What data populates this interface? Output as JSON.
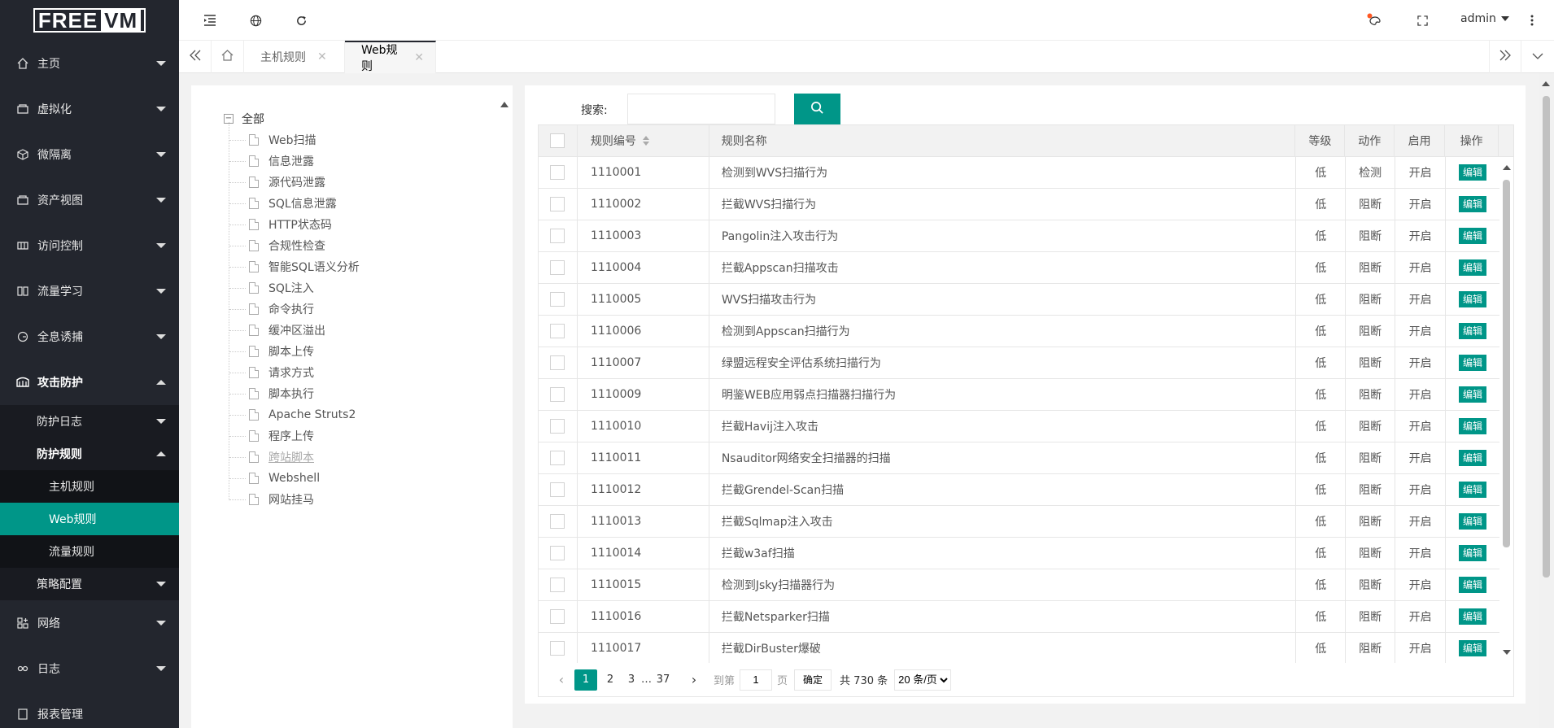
{
  "brand": {
    "logo_left": "FREE",
    "logo_right": "VM"
  },
  "sidebar": {
    "items": [
      {
        "label": "主页",
        "icon": "home-icon"
      },
      {
        "label": "虚拟化",
        "icon": "server-icon"
      },
      {
        "label": "微隔离",
        "icon": "cube-icon"
      },
      {
        "label": "资产视图",
        "icon": "server-icon"
      },
      {
        "label": "访问控制",
        "icon": "grid-icon"
      },
      {
        "label": "流量学习",
        "icon": "book-icon"
      },
      {
        "label": "全息诱捕",
        "icon": "radar-icon"
      },
      {
        "label": "攻击防护",
        "icon": "shield-icon"
      }
    ],
    "attack_sub": [
      {
        "label": "防护日志"
      },
      {
        "label": "防护规则"
      }
    ],
    "rules_sub": [
      {
        "label": "主机规则"
      },
      {
        "label": "Web规则"
      },
      {
        "label": "流量规则"
      }
    ],
    "policy": {
      "label": "策略配置"
    },
    "bottom_items": [
      {
        "label": "网络",
        "icon": "network-icon"
      },
      {
        "label": "日志",
        "icon": "link-icon"
      },
      {
        "label": "报表管理",
        "icon": "report-icon"
      }
    ]
  },
  "header": {
    "user": "admin"
  },
  "tabs": [
    {
      "label": "主机规则"
    },
    {
      "label": "Web规则"
    }
  ],
  "tree": {
    "root": "全部",
    "nodes": [
      "Web扫描",
      "信息泄露",
      "源代码泄露",
      "SQL信息泄露",
      "HTTP状态码",
      "合规性检查",
      "智能SQL语义分析",
      "SQL注入",
      "命令执行",
      "缓冲区溢出",
      "脚本上传",
      "请求方式",
      "脚本执行",
      "Apache Struts2",
      "程序上传",
      "跨站脚本",
      "Webshell",
      "网站挂马"
    ],
    "disabled_index": 15
  },
  "search": {
    "label": "搜索:",
    "value": "",
    "placeholder": ""
  },
  "table": {
    "headers": {
      "id": "规则编号",
      "name": "规则名称",
      "level": "等级",
      "action": "动作",
      "enabled": "启用",
      "op": "操作"
    },
    "edit_label": "编辑",
    "rows": [
      {
        "id": "1110001",
        "name": "检测到WVS扫描行为",
        "level": "低",
        "action": "检测",
        "enabled": "开启"
      },
      {
        "id": "1110002",
        "name": "拦截WVS扫描行为",
        "level": "低",
        "action": "阻断",
        "enabled": "开启"
      },
      {
        "id": "1110003",
        "name": "Pangolin注入攻击行为",
        "level": "低",
        "action": "阻断",
        "enabled": "开启"
      },
      {
        "id": "1110004",
        "name": "拦截Appscan扫描攻击",
        "level": "低",
        "action": "阻断",
        "enabled": "开启"
      },
      {
        "id": "1110005",
        "name": "WVS扫描攻击行为",
        "level": "低",
        "action": "阻断",
        "enabled": "开启"
      },
      {
        "id": "1110006",
        "name": "检测到Appscan扫描行为",
        "level": "低",
        "action": "阻断",
        "enabled": "开启"
      },
      {
        "id": "1110007",
        "name": "绿盟远程安全评估系统扫描行为",
        "level": "低",
        "action": "阻断",
        "enabled": "开启"
      },
      {
        "id": "1110009",
        "name": "明鉴WEB应用弱点扫描器扫描行为",
        "level": "低",
        "action": "阻断",
        "enabled": "开启"
      },
      {
        "id": "1110010",
        "name": "拦截Havij注入攻击",
        "level": "低",
        "action": "阻断",
        "enabled": "开启"
      },
      {
        "id": "1110011",
        "name": "Nsauditor网络安全扫描器的扫描",
        "level": "低",
        "action": "阻断",
        "enabled": "开启"
      },
      {
        "id": "1110012",
        "name": "拦截Grendel-Scan扫描",
        "level": "低",
        "action": "阻断",
        "enabled": "开启"
      },
      {
        "id": "1110013",
        "name": "拦截Sqlmap注入攻击",
        "level": "低",
        "action": "阻断",
        "enabled": "开启"
      },
      {
        "id": "1110014",
        "name": "拦截w3af扫描",
        "level": "低",
        "action": "阻断",
        "enabled": "开启"
      },
      {
        "id": "1110015",
        "name": "检测到Jsky扫描器行为",
        "level": "低",
        "action": "阻断",
        "enabled": "开启"
      },
      {
        "id": "1110016",
        "name": "拦截Netsparker扫描",
        "level": "低",
        "action": "阻断",
        "enabled": "开启"
      },
      {
        "id": "1110017",
        "name": "拦截DirBuster爆破",
        "level": "低",
        "action": "阻断",
        "enabled": "开启"
      }
    ]
  },
  "pager": {
    "pages": [
      "1",
      "2",
      "3"
    ],
    "ellipsis": "…",
    "last": "37",
    "goto_label": "到第",
    "goto_value": "1",
    "page_unit": "页",
    "ok": "确定",
    "total": "共 730 条",
    "size": "20 条/页"
  },
  "colors": {
    "accent": "#009688",
    "sidebar": "#23262e"
  }
}
